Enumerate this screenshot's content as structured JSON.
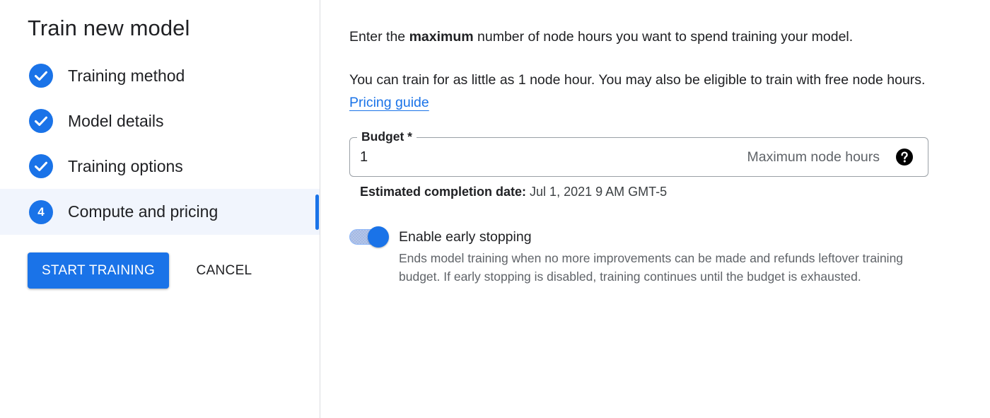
{
  "wizard": {
    "title": "Train new model",
    "steps": [
      {
        "label": "Training method",
        "status": "complete",
        "icon": "check-circle-icon"
      },
      {
        "label": "Model details",
        "status": "complete",
        "icon": "check-circle-icon"
      },
      {
        "label": "Training options",
        "status": "complete",
        "icon": "check-circle-icon"
      },
      {
        "label": "Compute and pricing",
        "status": "active",
        "number": "4"
      }
    ],
    "start_label": "START TRAINING",
    "cancel_label": "CANCEL"
  },
  "content": {
    "intro_prefix": "Enter the ",
    "intro_bold": "maximum",
    "intro_suffix": " number of node hours you want to spend training your model.",
    "info_text": "You can train for as little as 1 node hour. You may also be eligible to train with free node hours. ",
    "pricing_link": "Pricing guide",
    "budget": {
      "label": "Budget *",
      "value": "1",
      "suffix": "Maximum node hours",
      "help_icon": "help-circle-icon"
    },
    "estimate_label": "Estimated completion date:",
    "estimate_value": " Jul 1, 2021 9 AM GMT-5",
    "early_stopping": {
      "enabled": true,
      "title": "Enable early stopping",
      "description": "Ends model training when no more improvements can be made and refunds leftover training budget. If early stopping is disabled, training continues until the budget is exhausted."
    }
  },
  "colors": {
    "accent": "#1a73e8",
    "active_step_bg": "#f1f5fd",
    "divider": "#dadce0"
  }
}
